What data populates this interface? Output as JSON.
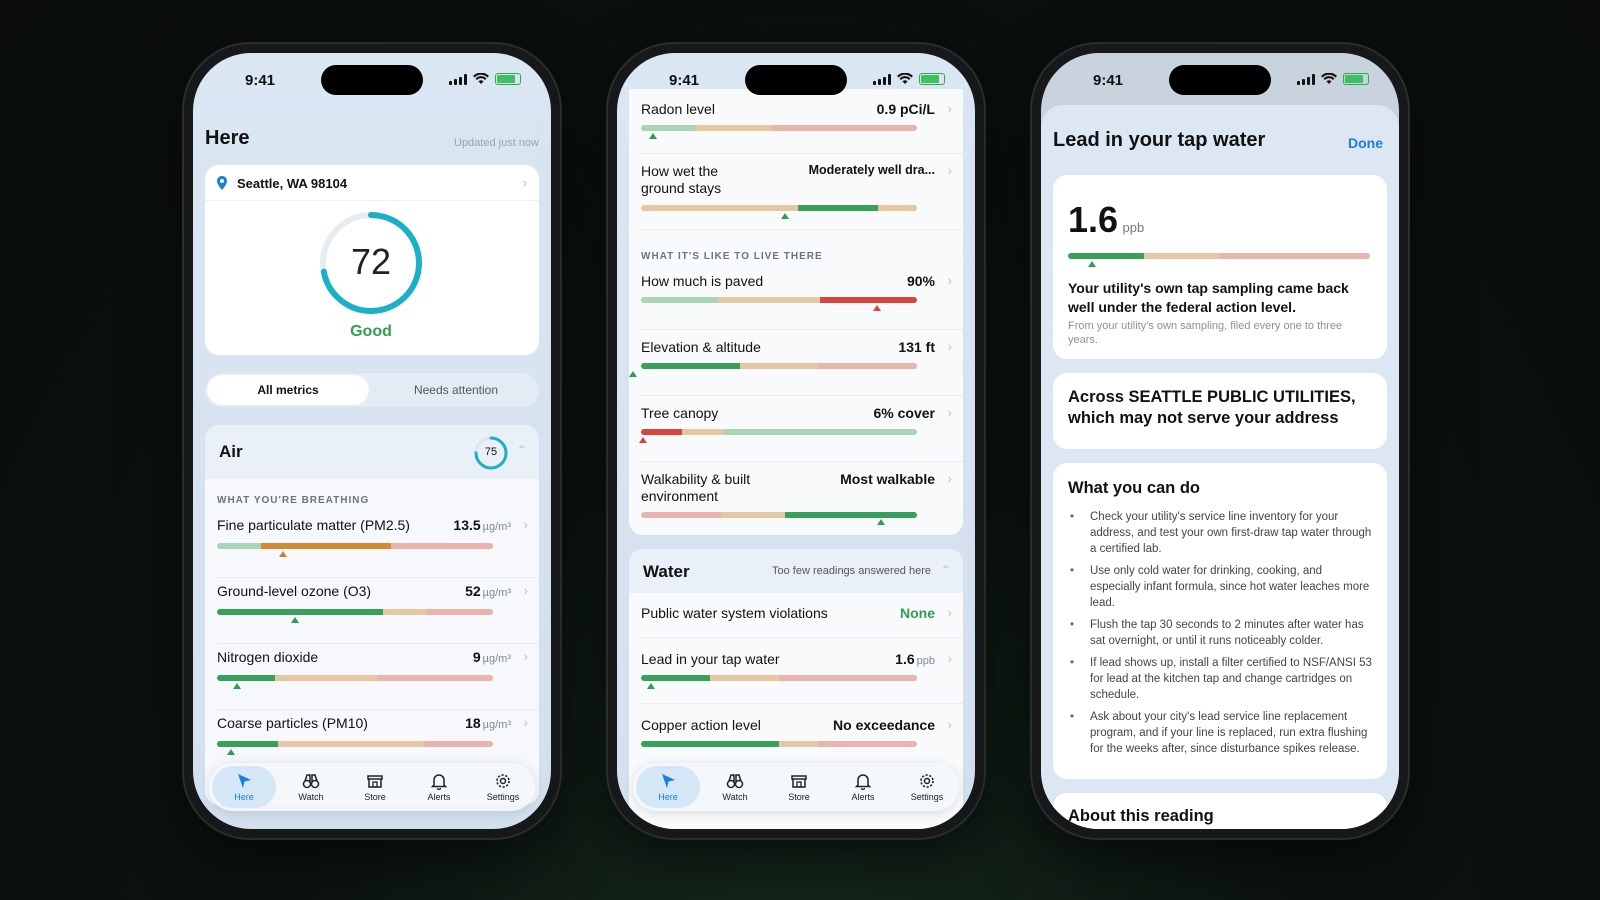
{
  "status": {
    "time": "9:41"
  },
  "phone1": {
    "title": "Here",
    "updated": "Updated just now",
    "location": "Seattle, WA 98104",
    "score": "72",
    "score_value": 72,
    "score_label": "Good",
    "seg_all": "All metrics",
    "seg_attention": "Needs attention",
    "air_title": "Air",
    "air_score": "75",
    "air_section": "WHAT YOU'RE BREATHING",
    "metrics": [
      {
        "name": "Fine particulate matter (PM2.5)",
        "value": "13.5",
        "unit": "µg/m³"
      },
      {
        "name": "Ground-level ozone (O3)",
        "value": "52",
        "unit": "µg/m³"
      },
      {
        "name": "Nitrogen dioxide",
        "value": "9",
        "unit": "µg/m³"
      },
      {
        "name": "Coarse particles (PM10)",
        "value": "18",
        "unit": "µg/m³"
      }
    ]
  },
  "phone2": {
    "metrics_top": [
      {
        "name": "Radon level",
        "value": "0.9 pCi/L"
      },
      {
        "name": "How wet the ground stays",
        "value": "Moderately well dra..."
      }
    ],
    "section": "WHAT IT'S LIKE TO LIVE THERE",
    "metrics_live": [
      {
        "name": "How much is paved",
        "value": "90%"
      },
      {
        "name": "Elevation & altitude",
        "value": "131 ft"
      },
      {
        "name": "Tree canopy",
        "value": "6% cover"
      },
      {
        "name": "Walkability & built environment",
        "value": "Most walkable"
      }
    ],
    "water_title": "Water",
    "water_note": "Too few readings answered here",
    "water_metrics": [
      {
        "name": "Public water system violations",
        "value": "None"
      },
      {
        "name": "Lead in your tap water",
        "value": "1.6",
        "unit": "ppb"
      },
      {
        "name": "Copper action level",
        "value": "No exceedance"
      }
    ]
  },
  "phone3": {
    "title": "Lead in your tap water",
    "done": "Done",
    "big_value": "1.6",
    "big_unit": "ppb",
    "headline": "Your utility's own tap sampling came back well under the federal action level.",
    "source": "From your utility's own sampling, filed every one to three years.",
    "across": "Across SEATTLE PUBLIC UTILITIES, which may not serve your address",
    "todo_title": "What you can do",
    "todo": [
      "Check your utility's service line inventory for your address, and test your own first-draw tap water through a certified lab.",
      "Use only cold water for drinking, cooking, and especially infant formula, since hot water leaches more lead.",
      "Flush the tap 30 seconds to 2 minutes after water has sat overnight, or until it runs noticeably colder.",
      "If lead shows up, install a filter certified to NSF/ANSI 53 for lead at the kitchen tap and change cartridges on schedule.",
      "Ask about your city's lead service line replacement program, and if your line is replaced, run extra flushing for the weeks after, since disturbance spikes release."
    ],
    "about_title": "About this reading"
  },
  "tabs": [
    "Here",
    "Watch",
    "Store",
    "Alerts",
    "Settings"
  ],
  "colors": {
    "accent": "#1a7fd8",
    "good": "#2f9e52",
    "warn": "#c9812b",
    "bad": "#d8453a"
  }
}
